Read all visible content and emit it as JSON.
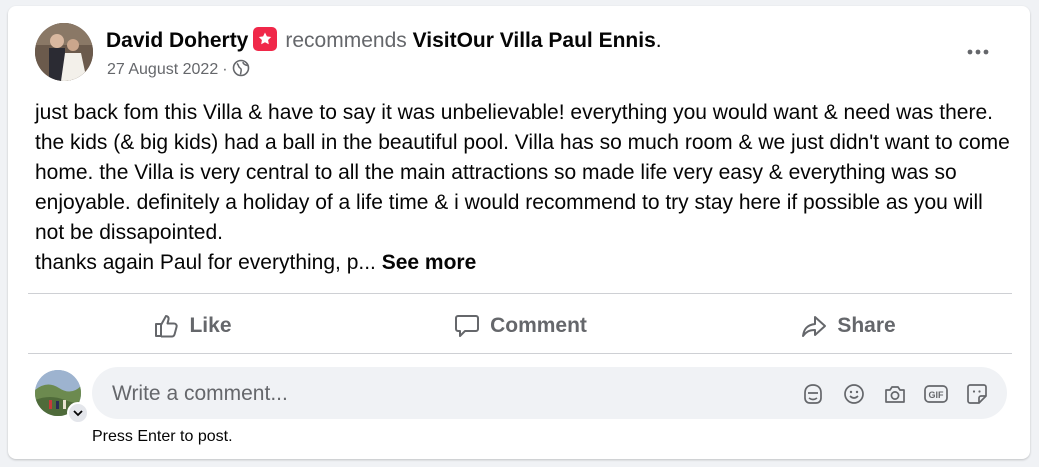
{
  "post": {
    "author": "David Doherty",
    "verb": "recommends",
    "page_name": "VisitOur Villa Paul Ennis",
    "page_suffix": ".",
    "date": "27 August 2022",
    "separator": "·",
    "audience_icon": "globe-icon",
    "body": "just back fom this Villa & have to say it was unbelievable! everything you would want & need was there. the kids (& big kids) had a ball in the beautiful pool. Villa has so much room & we just didn't want to come home. the Villa is very central to all the main attractions so made life very easy & everything was so enjoyable. definitely a holiday of a life time & i would recommend to try stay here if possible as you will not be dissapointed.\nthanks again Paul for everything, p... ",
    "see_more": "See more"
  },
  "actions": {
    "like": "Like",
    "comment": "Comment",
    "share": "Share"
  },
  "comment_box": {
    "placeholder": "Write a comment...",
    "hint": "Press Enter to post.",
    "icons": [
      "avatar-sticker-icon",
      "emoji-icon",
      "camera-icon",
      "gif-icon",
      "sticker-icon"
    ]
  },
  "colors": {
    "badge": "#f02849",
    "secondary_text": "#65676b",
    "divider": "#ced0d4",
    "input_bg": "#f0f2f5"
  }
}
